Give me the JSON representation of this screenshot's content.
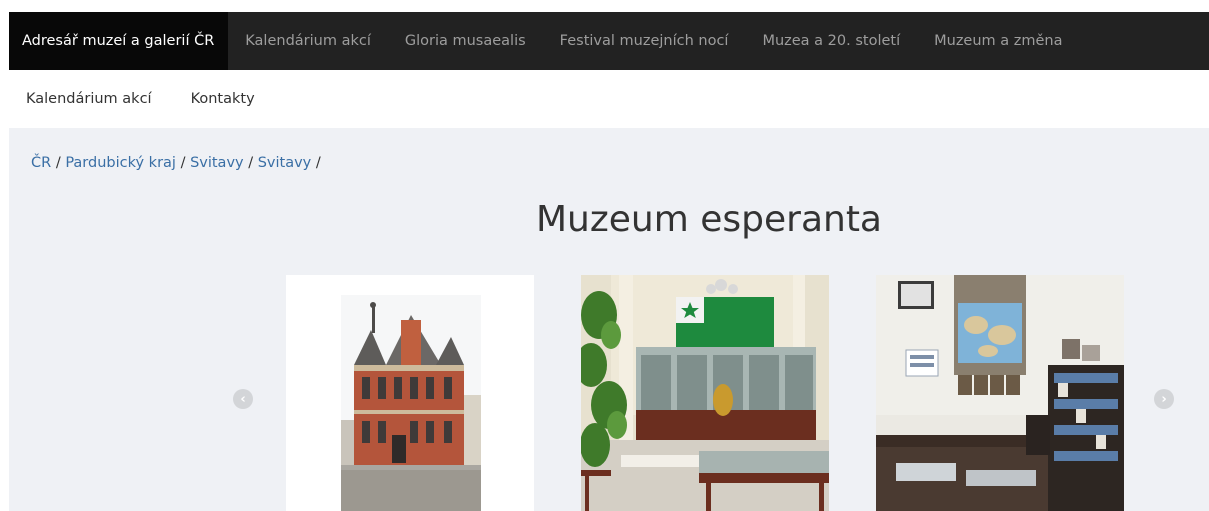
{
  "top_nav": {
    "items": [
      {
        "label": "Adresář muzeí a galerií ČR",
        "active": true
      },
      {
        "label": "Kalendárium akcí",
        "active": false
      },
      {
        "label": "Gloria musaealis",
        "active": false
      },
      {
        "label": "Festival muzejních nocí",
        "active": false
      },
      {
        "label": "Muzea a 20. století",
        "active": false
      },
      {
        "label": "Muzeum a změna",
        "active": false
      }
    ]
  },
  "sub_nav": {
    "items": [
      {
        "label": "Kalendárium akcí"
      },
      {
        "label": "Kontakty"
      }
    ]
  },
  "breadcrumb": {
    "items": [
      "ČR",
      "Pardubický kraj",
      "Svitavy",
      "Svitavy"
    ],
    "separator": "/"
  },
  "page": {
    "title": "Muzeum esperanta"
  },
  "carousel": {
    "prev_icon": "chevron-left-icon",
    "next_icon": "chevron-right-icon",
    "prev_glyph": "‹",
    "next_glyph": "›",
    "slides": [
      {
        "subject": "museum-building-photo"
      },
      {
        "subject": "exhibition-hall-photo"
      },
      {
        "subject": "library-room-photo"
      }
    ]
  },
  "colors": {
    "nav_bg": "#222222",
    "nav_active_bg": "#080808",
    "nav_text": "#9d9d9d",
    "link": "#3a6fa5",
    "content_bg": "#eff1f5",
    "esperanto_flag_green": "#1e8a3e"
  }
}
